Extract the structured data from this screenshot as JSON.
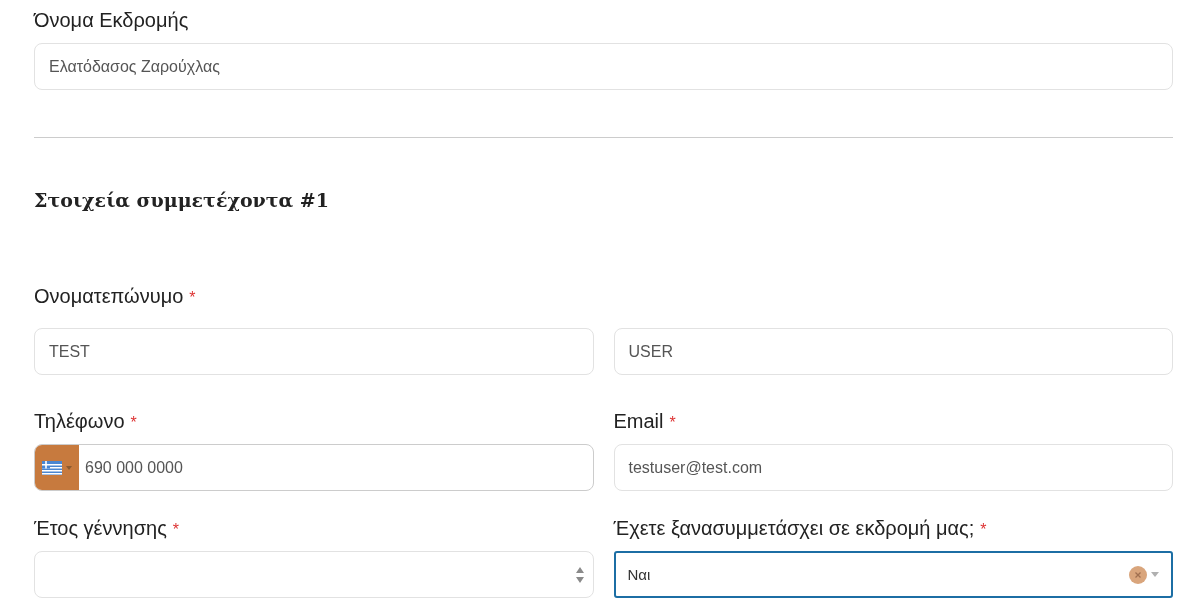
{
  "trip": {
    "label": "Όνομα Εκδρομής",
    "value": "Ελατόδασος Ζαρούχλας"
  },
  "participant": {
    "heading": "Στοιχεία συμμετέχοντα #1",
    "name": {
      "label": "Ονοματεπώνυμο",
      "required_mark": "*",
      "values": [
        "TEST",
        "USER"
      ]
    },
    "fields": [
      {
        "kind": "phone",
        "label": "Τηλέφωνο",
        "required_mark": "*",
        "value": "690 000 0000"
      },
      {
        "kind": "text",
        "label": "Email",
        "required_mark": "*",
        "value": "testuser@test.com"
      },
      {
        "kind": "number",
        "label": "Έτος γέννησης",
        "required_mark": "*"
      },
      {
        "kind": "select",
        "label": "Έχετε ξανασυμμετάσχει σε εκδρομή μας;",
        "required_mark": "*",
        "value": "Ναι",
        "focused": true
      }
    ]
  }
}
